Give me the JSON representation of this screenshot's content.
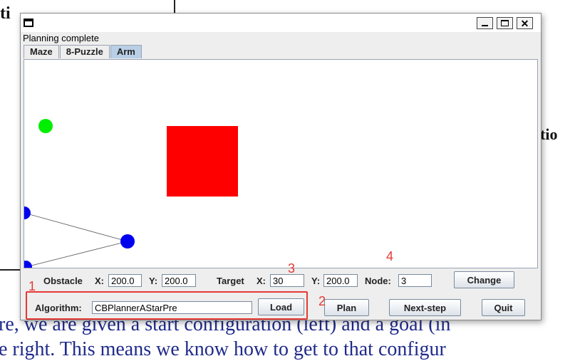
{
  "background_document": {
    "fragment_top": "ti",
    "fragment_right": "tio",
    "body_line_1": "re, we are given a start configuration (left) and a goal (in",
    "body_line_2": "e right. This means we know how to get to that configur"
  },
  "window": {
    "status": "Planning complete",
    "tabs": [
      {
        "label": "Maze",
        "active": false
      },
      {
        "label": "8-Puzzle",
        "active": false
      },
      {
        "label": "Arm",
        "active": true
      }
    ]
  },
  "canvas": {
    "obstacle_color": "#ff0000",
    "goal_color": "#00ee00",
    "arm_joint_color": "#0000ee"
  },
  "controls": {
    "obstacle": {
      "label": "Obstacle",
      "x_label": "X:",
      "x_value": "200.0",
      "y_label": "Y:",
      "y_value": "200.0"
    },
    "target": {
      "label": "Target",
      "x_label": "X:",
      "x_value": "30",
      "y_label": "Y:",
      "y_value": "200.0"
    },
    "node": {
      "label": "Node:",
      "value": "3"
    },
    "change_label": "Change",
    "algorithm": {
      "label": "Algorithm:",
      "value": "CBPlannerAStarPre"
    },
    "load_label": "Load",
    "plan_label": "Plan",
    "next_step_label": "Next-step",
    "quit_label": "Quit"
  },
  "annotations": {
    "n1": "1",
    "n2": "2",
    "n3": "3",
    "n4": "4",
    "color": "#e53935"
  }
}
